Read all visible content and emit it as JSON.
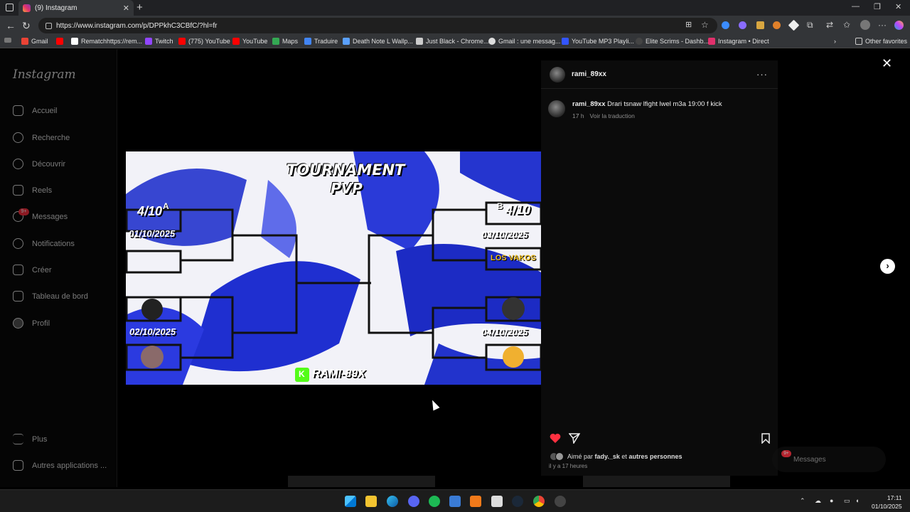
{
  "browser": {
    "tab_title": "(9) Instagram",
    "tab_close": "✕",
    "new_tab": "+",
    "url": "https://www.instagram.com/p/DPPkhC3CBfC/?hl=fr",
    "window_controls": [
      "—",
      "❐",
      "✕"
    ]
  },
  "bookmarks": [
    {
      "label": "Gmail",
      "color": "#ea4335"
    },
    {
      "label": "",
      "color": "#ff0000"
    },
    {
      "label": "Rematchhttps://rem...",
      "color": "#ffffff"
    },
    {
      "label": "Twitch",
      "color": "#9146ff"
    },
    {
      "label": "(775) YouTube",
      "color": "#ff0000"
    },
    {
      "label": "YouTube",
      "color": "#ff0000"
    },
    {
      "label": "Maps",
      "color": "#34a853"
    },
    {
      "label": "Traduire",
      "color": "#4285f4"
    },
    {
      "label": "Death Note L Wallp...",
      "color": "#5aa0ff"
    },
    {
      "label": "Just Black - Chrome...",
      "color": "#cccccc"
    },
    {
      "label": "Gmail : une messag...",
      "color": "#dddddd"
    },
    {
      "label": "YouTube MP3 Playli...",
      "color": "#3355ff"
    },
    {
      "label": "Elite Scrims - Dashb...",
      "color": "#222222"
    },
    {
      "label": "Instagram • Direct",
      "color": "#e1306c"
    }
  ],
  "other_favorites": "Other favorites",
  "instagram": {
    "logo": "Instagram",
    "nav": [
      {
        "label": "Accueil",
        "icon": "home-icon"
      },
      {
        "label": "Recherche",
        "icon": "search-icon"
      },
      {
        "label": "Découvrir",
        "icon": "compass-icon"
      },
      {
        "label": "Reels",
        "icon": "reels-icon"
      },
      {
        "label": "Messages",
        "icon": "messenger-icon"
      },
      {
        "label": "Notifications",
        "icon": "heart-icon"
      },
      {
        "label": "Créer",
        "icon": "plus-icon"
      },
      {
        "label": "Tableau de bord",
        "icon": "dashboard-icon"
      },
      {
        "label": "Profil",
        "icon": "avatar"
      }
    ],
    "messages_badge": "9+",
    "more": "Plus",
    "other_apps": "Autres applications ..."
  },
  "post": {
    "username": "rami_89xx",
    "more": "···",
    "caption_user": "rami_89xx",
    "caption_text": "Drari tsnaw lfight lwel m3a 19:00 f kick",
    "time": "17 h",
    "see_translation": "Voir la traduction",
    "liked_prefix": "Aimé par",
    "liked_user": "fady._sk",
    "liked_and": "et",
    "liked_others": "autres personnes",
    "ago": "il y a 17 heures",
    "image": {
      "title_line1": "TOURNAMENT",
      "title_line2": "PVP",
      "left_tag": "A",
      "left_slot": "4/10",
      "right_tag": "B",
      "right_slot": "4/10",
      "date1": "01/10/2025",
      "date2": "02/10/2025",
      "date3": "03/10/2025",
      "date4": "04/10/2025",
      "team_right_1": "LOS VAKOS",
      "kick_badge": "K",
      "signature": "RAMI-89X"
    }
  },
  "floating_messages": {
    "label": "Messages",
    "badge": "9+"
  },
  "taskbar": {
    "time": "17:11",
    "date": "01/10/2025"
  }
}
